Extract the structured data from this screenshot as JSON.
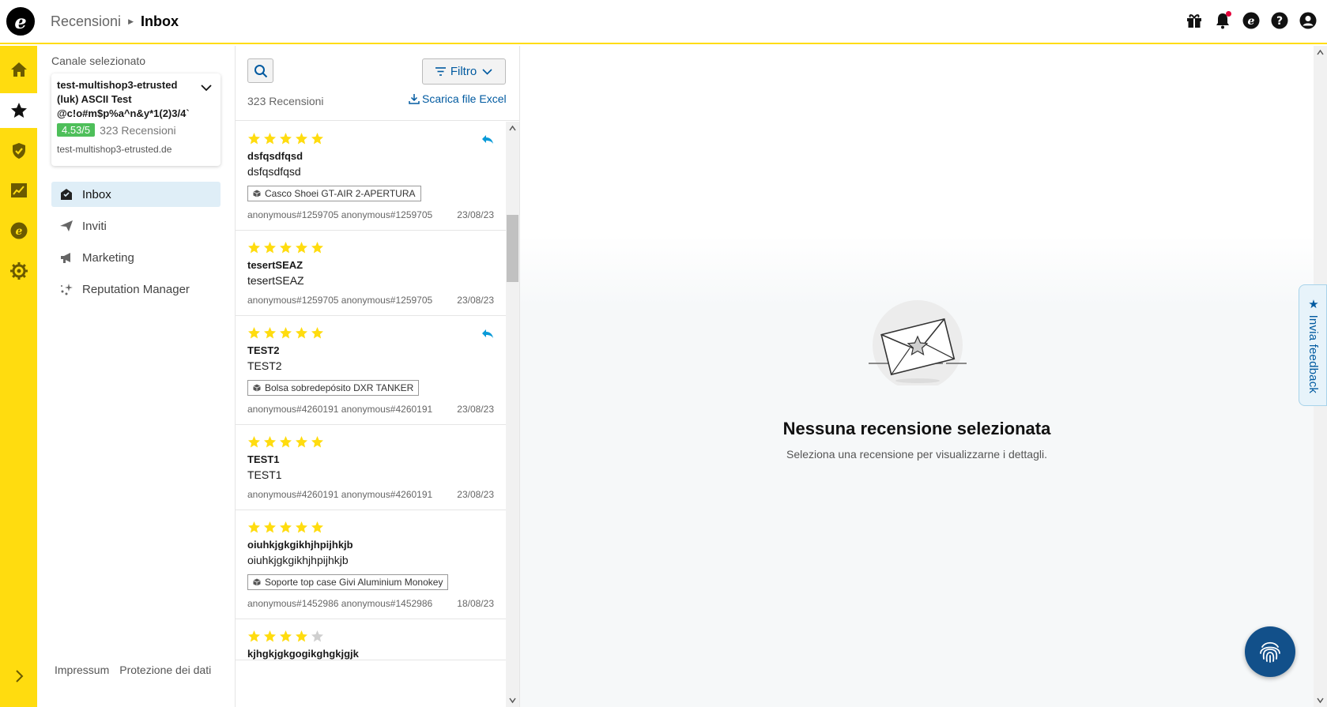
{
  "header": {
    "logo_letter": "e",
    "breadcrumb_parent": "Recensioni",
    "breadcrumb_current": "Inbox",
    "icons": [
      "gift-icon",
      "bell-icon",
      "etrusted-icon",
      "help-icon",
      "account-icon"
    ]
  },
  "rail": {
    "items": [
      "home-icon",
      "star-icon",
      "shield-icon",
      "chart-icon",
      "etrusted-icon",
      "gear-icon"
    ],
    "active": "star-icon",
    "expand_icon": "chevron-right-icon"
  },
  "nav": {
    "channel_label": "Canale selezionato",
    "channel": {
      "name": "test-multishop3-etrusted (luk) ASCII Test @c!o#m$p%a^n&y*1(2)3/4`",
      "rating": "4.53/5",
      "reviews": "323 Recensioni",
      "domain": "test-multishop3-etrusted.de"
    },
    "items": [
      {
        "label": "Inbox",
        "icon": "inbox-icon",
        "active": true
      },
      {
        "label": "Inviti",
        "icon": "send-icon",
        "active": false
      },
      {
        "label": "Marketing",
        "icon": "megaphone-icon",
        "active": false
      },
      {
        "label": "Reputation Manager",
        "icon": "sparkle-icon",
        "active": false
      }
    ],
    "footer": {
      "impressum": "Impressum",
      "privacy": "Protezione dei dati"
    }
  },
  "list": {
    "filter_label": "Filtro",
    "count": "323 Recensioni",
    "excel_label": "Scarica file Excel",
    "reviews": [
      {
        "stars": 5,
        "replied": true,
        "title": "dsfqsdfqsd",
        "text": "dsfqsdfqsd",
        "product": "Casco Shoei GT-AIR 2-APERTURA",
        "author": "anonymous#1259705 anonymous#1259705",
        "date": "23/08/23"
      },
      {
        "stars": 5,
        "replied": false,
        "title": "tesertSEAZ",
        "text": "tesertSEAZ",
        "product": "",
        "author": "anonymous#1259705 anonymous#1259705",
        "date": "23/08/23"
      },
      {
        "stars": 5,
        "replied": true,
        "title": "TEST2",
        "text": "TEST2",
        "product": "Bolsa sobredepósito DXR TANKER",
        "author": "anonymous#4260191 anonymous#4260191",
        "date": "23/08/23"
      },
      {
        "stars": 5,
        "replied": false,
        "title": "TEST1",
        "text": "TEST1",
        "product": "",
        "author": "anonymous#4260191 anonymous#4260191",
        "date": "23/08/23"
      },
      {
        "stars": 5,
        "replied": false,
        "title": "oiuhkjgkgikhjhpijhkjb",
        "text": "oiuhkjgkgikhjhpijhkjb",
        "product": "Soporte top case Givi Aluminium Monokey",
        "author": "anonymous#1452986 anonymous#1452986",
        "date": "18/08/23"
      },
      {
        "stars": 4,
        "replied": false,
        "title": "kjhgkjgkgogikghgkjgjk",
        "text": "",
        "product": "",
        "author": "",
        "date": ""
      }
    ]
  },
  "detail": {
    "empty_title": "Nessuna recensione selezionata",
    "empty_subtitle": "Seleziona una recensione per visualizzarne i dettagli."
  },
  "feedback": {
    "label": "★ Invia feedback"
  },
  "colors": {
    "brand_yellow": "#ffdc0f",
    "link_blue": "#005aa0",
    "rating_green": "#4ebf5a",
    "star": "#ffdc0f",
    "reply": "#0a9ad8"
  }
}
